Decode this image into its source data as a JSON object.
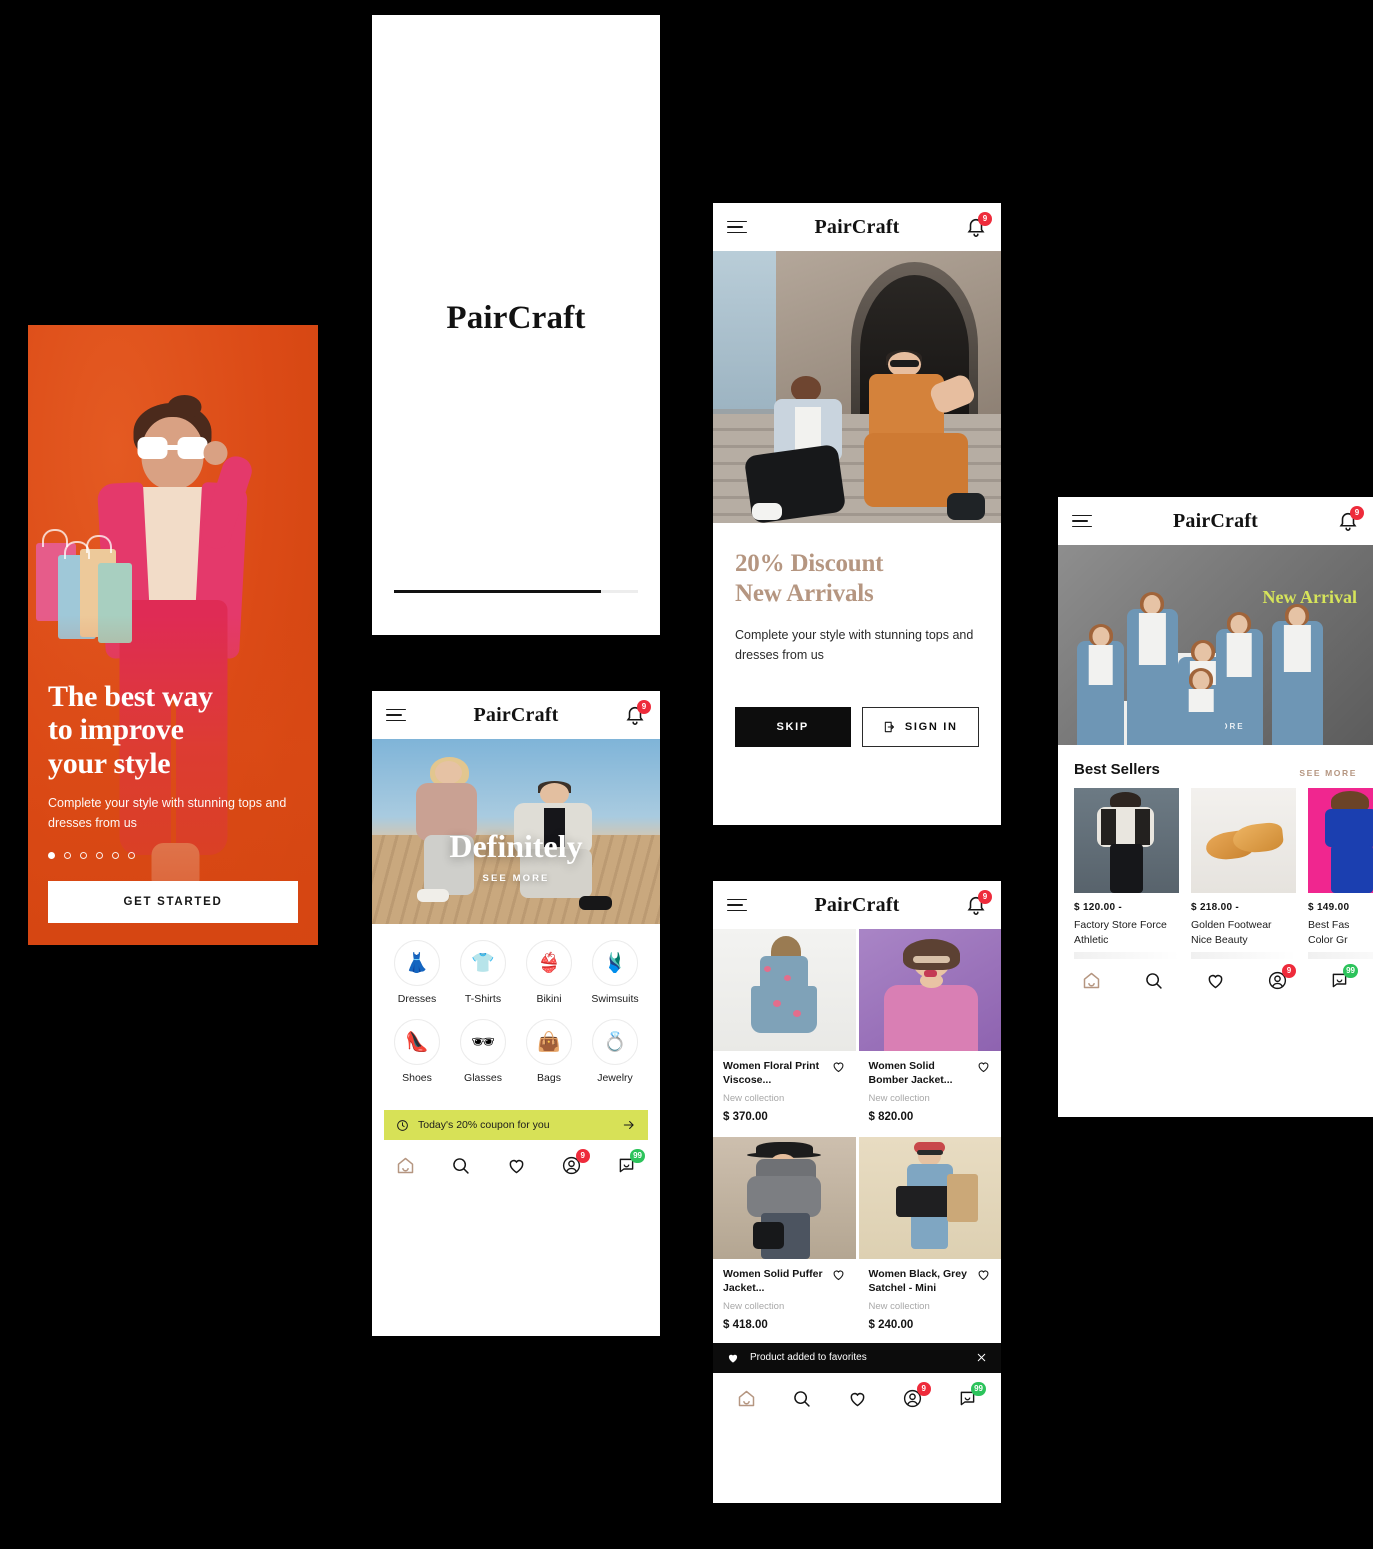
{
  "brand": {
    "name": "PairCraft",
    "accent": "#B59681",
    "orange": "#DF4F1B",
    "lime": "#D7E157",
    "red": "#EE2B3B",
    "green": "#2CC35B"
  },
  "onboarding": {
    "title_line1": "The best way",
    "title_line2": "to improve",
    "title_line3": "your style",
    "subtitle": "Complete your style with stunning tops and dresses from us",
    "cta_label": "GET STARTED",
    "dots_total": 6,
    "dot_active_index": 0
  },
  "splash": {
    "logo": "PairCraft",
    "progress_percent": 85
  },
  "discount": {
    "header": {
      "logo": "PairCraft",
      "menu_icon": "hamburger-icon",
      "bell_icon": "bell-icon",
      "bell_badge": "9"
    },
    "title_line1": "20% Discount",
    "title_line2": "New Arrivals",
    "subtitle": "Complete your style with stunning tops and dresses from us",
    "skip_label": "SKIP",
    "signin_label": "SIGN IN",
    "signin_icon": "login-icon"
  },
  "home": {
    "header": {
      "logo": "PairCraft",
      "menu_icon": "hamburger-icon",
      "bell_icon": "bell-icon",
      "bell_badge": "9"
    },
    "hero": {
      "title": "Definitely",
      "see_more": "SEE MORE"
    },
    "categories": [
      {
        "label": "Dresses",
        "icon": "dress-icon",
        "glyph": "👗"
      },
      {
        "label": "T-Shirts",
        "icon": "tshirt-icon",
        "glyph": "👕"
      },
      {
        "label": "Bikini",
        "icon": "bikini-icon",
        "glyph": "👙"
      },
      {
        "label": "Swimsuits",
        "icon": "swimsuit-icon",
        "glyph": "🩱"
      },
      {
        "label": "Shoes",
        "icon": "shoe-icon",
        "glyph": "👠"
      },
      {
        "label": "Glasses",
        "icon": "sunglasses-icon",
        "glyph": "🕶"
      },
      {
        "label": "Bags",
        "icon": "bag-icon",
        "glyph": "👜"
      },
      {
        "label": "Jewelry",
        "icon": "ring-icon",
        "glyph": "💍"
      }
    ],
    "coupon": {
      "text": "Today's 20% coupon for you",
      "icon": "clock-icon",
      "arrow": "arrow-right-icon"
    }
  },
  "catalog": {
    "header": {
      "logo": "PairCraft",
      "menu_icon": "hamburger-icon",
      "bell_icon": "bell-icon",
      "bell_badge": "9"
    },
    "products": [
      {
        "title": "Women Floral Print Viscose...",
        "subtitle": "New collection",
        "price": "$ 370.00"
      },
      {
        "title": "Women Solid Bomber Jacket...",
        "subtitle": "New collection",
        "price": "$ 820.00"
      },
      {
        "title": "Women Solid Puffer Jacket...",
        "subtitle": "New collection",
        "price": "$ 418.00"
      },
      {
        "title": "Women Black, Grey Satchel - Mini",
        "subtitle": "New collection",
        "price": "$ 240.00"
      }
    ],
    "toast": {
      "text": "Product added to favorites",
      "icon": "heart-filled-icon",
      "close_icon": "close-icon"
    }
  },
  "best": {
    "header": {
      "logo": "PairCraft",
      "menu_icon": "hamburger-icon",
      "bell_icon": "bell-icon",
      "bell_badge": "9"
    },
    "hero": {
      "title": "New Arrival",
      "see_more": "SEE MORE"
    },
    "section_title": "Best Sellers",
    "see_more": "SEE MORE",
    "items": [
      {
        "price": "$ 120.00 -",
        "name_line1": "Factory Store Force",
        "name_line2": "Athletic"
      },
      {
        "price": "$ 218.00 -",
        "name_line1": "Golden Footwear",
        "name_line2": "Nice Beauty"
      },
      {
        "price": "$ 149.00",
        "name_line1": "Best Fas",
        "name_line2": "Color Gr"
      }
    ]
  },
  "tabbar": {
    "items": [
      {
        "name": "home-tab",
        "icon": "home-icon",
        "badge": ""
      },
      {
        "name": "search-tab",
        "icon": "search-icon",
        "badge": ""
      },
      {
        "name": "favorites-tab",
        "icon": "heart-icon",
        "badge": ""
      },
      {
        "name": "profile-tab",
        "icon": "user-icon",
        "badge": "9"
      },
      {
        "name": "messages-tab",
        "icon": "messages-icon",
        "badge": "99"
      }
    ]
  }
}
